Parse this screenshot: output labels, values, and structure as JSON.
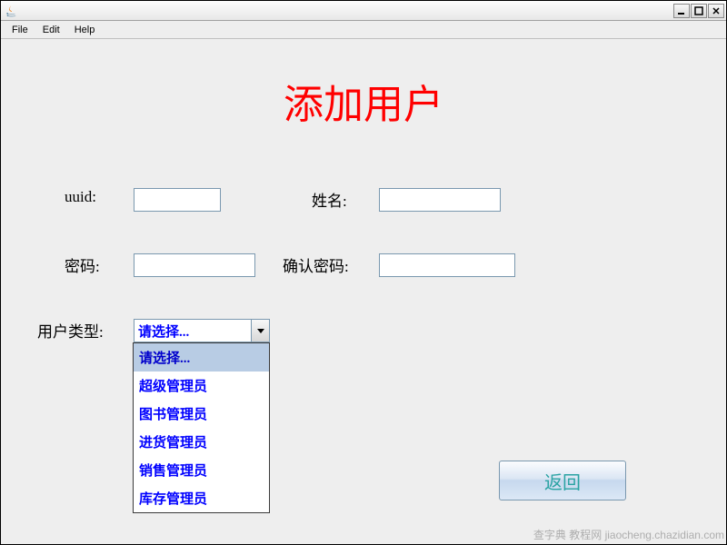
{
  "window": {
    "title": ""
  },
  "menubar": {
    "file": "File",
    "edit": "Edit",
    "help": "Help"
  },
  "page": {
    "title": "添加用户"
  },
  "form": {
    "uuid_label": "uuid:",
    "uuid_value": "",
    "name_label": "姓名:",
    "name_value": "",
    "password_label": "密码:",
    "password_value": "",
    "confirm_password_label": "确认密码:",
    "confirm_password_value": "",
    "user_type_label": "用户类型:",
    "user_type_selected": "请选择...",
    "user_type_options": [
      "请选择...",
      "超级管理员",
      "图书管理员",
      "进货管理员",
      "销售管理员",
      "库存管理员"
    ]
  },
  "buttons": {
    "back": "返回"
  },
  "watermark": "查字典 教程网 jiaocheng.chazidian.com"
}
